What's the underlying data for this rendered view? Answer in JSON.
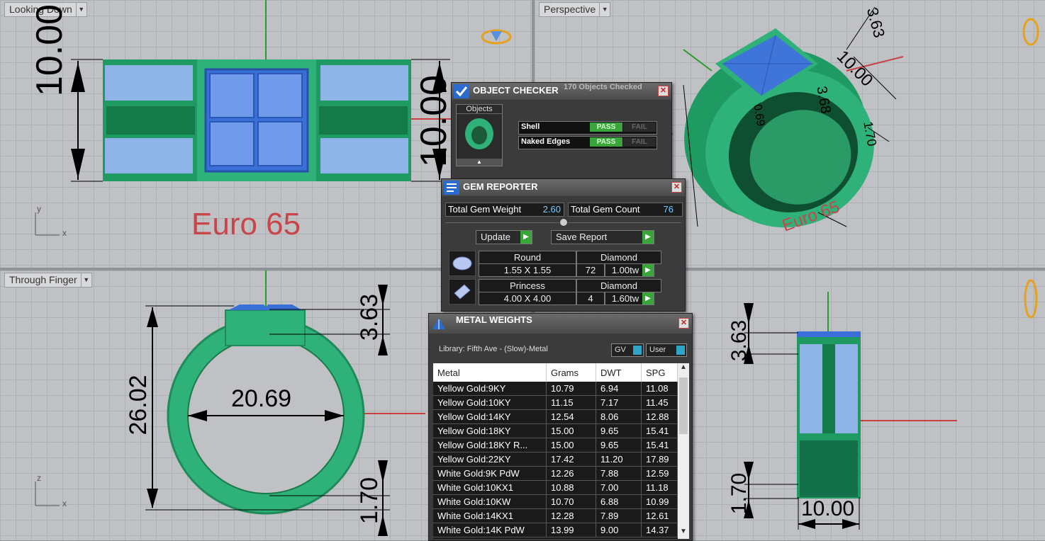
{
  "viewports": {
    "top_left": {
      "label": "Looking Down",
      "dim_left": "10.00",
      "dim_right": "10.00",
      "caption": "Euro 65",
      "axis_y": "y",
      "axis_x": "x"
    },
    "top_right": {
      "label": "Perspective",
      "dim_a": "3.63",
      "dim_b": "10.00",
      "dim_c": "10.00",
      "dim_d": "3.68",
      "dim_e": "1.70",
      "caption": "Euro 65",
      "dim_f": "0.69"
    },
    "bottom_left": {
      "label": "Through Finger",
      "dim_height": "26.02",
      "dim_inner": "20.69",
      "dim_top": "3.63",
      "dim_bottom": "1.70",
      "axis_z": "z",
      "axis_x": "x"
    },
    "bottom_right": {
      "dim_top": "3.63",
      "dim_bottom": "1.70",
      "dim_width": "10.00"
    }
  },
  "object_checker": {
    "title": "OBJECT CHECKER",
    "status": "170 Objects Checked",
    "objects_label": "Objects",
    "rows": [
      {
        "label": "Shell",
        "pass": "PASS",
        "fail": "FAIL"
      },
      {
        "label": "Naked Edges",
        "pass": "PASS",
        "fail": "FAIL"
      }
    ]
  },
  "gem_reporter": {
    "title": "GEM REPORTER",
    "total_weight_label": "Total Gem Weight",
    "total_weight_value": "2.60",
    "total_count_label": "Total Gem Count",
    "total_count_value": "76",
    "update_label": "Update",
    "save_label": "Save Report",
    "gems": [
      {
        "shape": "Round",
        "size": "1.55 X 1.55",
        "material": "Diamond",
        "count": "72",
        "weight": "1.00tw"
      },
      {
        "shape": "Princess",
        "size": "4.00 X 4.00",
        "material": "Diamond",
        "count": "4",
        "weight": "1.60tw"
      }
    ]
  },
  "metal_weights": {
    "title": "METAL WEIGHTS",
    "library": "Library: Fifth Ave - (Slow)-Metal",
    "toggle_gv": "GV",
    "toggle_user": "User",
    "columns": [
      "Metal",
      "Grams",
      "DWT",
      "SPG"
    ],
    "rows": [
      [
        "Yellow Gold:9KY",
        "10.79",
        "6.94",
        "11.08"
      ],
      [
        "Yellow Gold:10KY",
        "11.15",
        "7.17",
        "11.45"
      ],
      [
        "Yellow Gold:14KY",
        "12.54",
        "8.06",
        "12.88"
      ],
      [
        "Yellow Gold:18KY",
        "15.00",
        "9.65",
        "15.41"
      ],
      [
        "Yellow Gold:18KY R...",
        "15.00",
        "9.65",
        "15.41"
      ],
      [
        "Yellow Gold:22KY",
        "17.42",
        "11.20",
        "17.89"
      ],
      [
        "White Gold:9K PdW",
        "12.26",
        "7.88",
        "12.59"
      ],
      [
        "White Gold:10KX1",
        "10.88",
        "7.00",
        "11.18"
      ],
      [
        "White Gold:10KW",
        "10.70",
        "6.88",
        "10.99"
      ],
      [
        "White Gold:14KX1",
        "12.28",
        "7.89",
        "12.61"
      ],
      [
        "White Gold:14K PdW",
        "13.99",
        "9.00",
        "14.37"
      ]
    ]
  },
  "colors": {
    "ring_green": "#2fb27a",
    "stone_blue": "#4f86e0",
    "dim_red": "#d9534f"
  }
}
